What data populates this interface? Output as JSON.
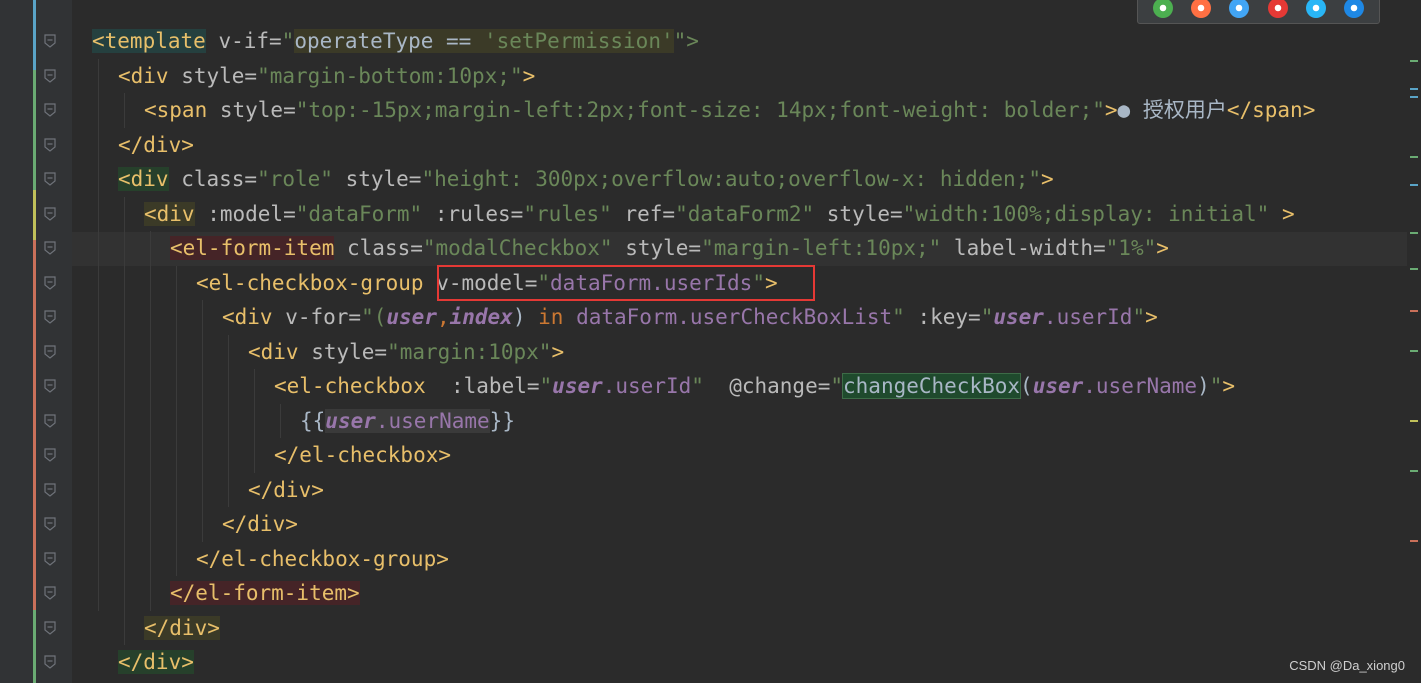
{
  "browser_icons": [
    {
      "name": "chrome-icon",
      "color": "#4caf50"
    },
    {
      "name": "firefox-icon",
      "color": "#ff7043"
    },
    {
      "name": "safari-icon",
      "color": "#42a5f5"
    },
    {
      "name": "opera-icon",
      "color": "#e53935"
    },
    {
      "name": "ie-icon",
      "color": "#29b6f6"
    },
    {
      "name": "edge-icon",
      "color": "#1e88e5"
    }
  ],
  "code": {
    "lines": [
      {
        "indent": 0,
        "tokens": [
          {
            "t": "<template",
            "c": "tag bg-teal"
          },
          {
            "t": " v-if=",
            "c": "attr"
          },
          {
            "t": "\"",
            "c": "str"
          },
          {
            "t": "operateType == ",
            "c": "vjs bg-olive"
          },
          {
            "t": "'setPermission'",
            "c": "str bg-olive"
          },
          {
            "t": "\">",
            "c": "str"
          }
        ]
      },
      {
        "indent": 1,
        "tokens": [
          {
            "t": "<div",
            "c": "tag"
          },
          {
            "t": " style=",
            "c": "attr"
          },
          {
            "t": "\"margin-bottom:10px;\"",
            "c": "str"
          },
          {
            "t": ">",
            "c": "tag"
          }
        ]
      },
      {
        "indent": 2,
        "tokens": [
          {
            "t": "<span",
            "c": "tag"
          },
          {
            "t": " style=",
            "c": "attr"
          },
          {
            "t": "\"top:-15px;margin-left:2px;font-size: 14px;font-weight: bolder;\"",
            "c": "str"
          },
          {
            "t": ">",
            "c": "tag"
          },
          {
            "t": "● 授权用户",
            "c": "vjs"
          },
          {
            "t": "</span>",
            "c": "tag"
          }
        ]
      },
      {
        "indent": 1,
        "tokens": [
          {
            "t": "</div>",
            "c": "tag"
          }
        ]
      },
      {
        "indent": 1,
        "tokens": [
          {
            "t": "<div",
            "c": "tag bg-green"
          },
          {
            "t": " class=",
            "c": "attr"
          },
          {
            "t": "\"role\"",
            "c": "str"
          },
          {
            "t": " style=",
            "c": "attr"
          },
          {
            "t": "\"height: 300px;overflow:auto;overflow-x: hidden;\"",
            "c": "str"
          },
          {
            "t": ">",
            "c": "tag"
          }
        ]
      },
      {
        "indent": 2,
        "tokens": [
          {
            "t": "<div",
            "c": "tag bg-olive"
          },
          {
            "t": " :model=",
            "c": "attr"
          },
          {
            "t": "\"dataForm\"",
            "c": "str"
          },
          {
            "t": " :rules=",
            "c": "attr"
          },
          {
            "t": "\"rules\"",
            "c": "str"
          },
          {
            "t": " ref=",
            "c": "attr"
          },
          {
            "t": "\"dataForm2\"",
            "c": "str"
          },
          {
            "t": " style=",
            "c": "attr"
          },
          {
            "t": "\"width:100%;display: initial\"",
            "c": "str"
          },
          {
            "t": " >",
            "c": "tag"
          }
        ]
      },
      {
        "indent": 3,
        "tokens": [
          {
            "t": "<el-form-item",
            "c": "tag bg-red"
          },
          {
            "t": " class=",
            "c": "attr"
          },
          {
            "t": "\"modalCheckbox\"",
            "c": "str"
          },
          {
            "t": " style=",
            "c": "attr"
          },
          {
            "t": "\"margin-left:10px;\"",
            "c": "str"
          },
          {
            "t": " label-width=",
            "c": "attr"
          },
          {
            "t": "\"1%\"",
            "c": "str"
          },
          {
            "t": ">",
            "c": "tag"
          }
        ]
      },
      {
        "indent": 4,
        "tokens": [
          {
            "t": "<el-checkbox-group",
            "c": "tag"
          },
          {
            "t": " v-model=",
            "c": "attr"
          },
          {
            "t": "\"",
            "c": "str"
          },
          {
            "t": "dataForm.userIds",
            "c": "prop"
          },
          {
            "t": "\"",
            "c": "str"
          },
          {
            "t": ">",
            "c": "tag"
          }
        ]
      },
      {
        "indent": 5,
        "tokens": [
          {
            "t": "<div",
            "c": "tag"
          },
          {
            "t": " v-for=",
            "c": "attr"
          },
          {
            "t": "\"(",
            "c": "str"
          },
          {
            "t": "user",
            "c": "var"
          },
          {
            "t": ",",
            "c": "kw"
          },
          {
            "t": "index",
            "c": "var"
          },
          {
            "t": ") ",
            "c": "vjs"
          },
          {
            "t": "in",
            "c": "kw"
          },
          {
            "t": " dataForm.userCheckBoxList",
            "c": "prop"
          },
          {
            "t": "\"",
            "c": "str"
          },
          {
            "t": " :key=",
            "c": "attr"
          },
          {
            "t": "\"",
            "c": "str"
          },
          {
            "t": "user",
            "c": "var"
          },
          {
            "t": ".userId",
            "c": "prop"
          },
          {
            "t": "\"",
            "c": "str"
          },
          {
            "t": ">",
            "c": "tag"
          }
        ]
      },
      {
        "indent": 6,
        "tokens": [
          {
            "t": "<div",
            "c": "tag"
          },
          {
            "t": " style=",
            "c": "attr"
          },
          {
            "t": "\"margin:10px\"",
            "c": "str"
          },
          {
            "t": ">",
            "c": "tag"
          }
        ]
      },
      {
        "indent": 7,
        "tokens": [
          {
            "t": "<el-checkbox",
            "c": "tag"
          },
          {
            "t": "  :label=",
            "c": "attr"
          },
          {
            "t": "\"",
            "c": "str"
          },
          {
            "t": "user",
            "c": "var"
          },
          {
            "t": ".userId",
            "c": "prop"
          },
          {
            "t": "\"",
            "c": "str"
          },
          {
            "t": "  @change=",
            "c": "attr"
          },
          {
            "t": "\"",
            "c": "str"
          },
          {
            "t": "changeCheckBox",
            "c": "vjs bg-fn"
          },
          {
            "t": "(",
            "c": "vjs"
          },
          {
            "t": "user",
            "c": "var"
          },
          {
            "t": ".userName",
            "c": "prop"
          },
          {
            "t": ")",
            "c": "vjs"
          },
          {
            "t": "\"",
            "c": "str"
          },
          {
            "t": ">",
            "c": "tag"
          }
        ]
      },
      {
        "indent": 8,
        "tokens": [
          {
            "t": "{{",
            "c": "vjs"
          },
          {
            "t": "user",
            "c": "var bg-gray"
          },
          {
            "t": ".userName",
            "c": "prop bg-gray"
          },
          {
            "t": "}}",
            "c": "vjs"
          }
        ]
      },
      {
        "indent": 7,
        "tokens": [
          {
            "t": "</el-checkbox>",
            "c": "tag"
          }
        ]
      },
      {
        "indent": 6,
        "tokens": [
          {
            "t": "</div>",
            "c": "tag"
          }
        ]
      },
      {
        "indent": 5,
        "tokens": [
          {
            "t": "</div>",
            "c": "tag"
          }
        ]
      },
      {
        "indent": 4,
        "tokens": [
          {
            "t": "</el-checkbox-group>",
            "c": "tag"
          }
        ]
      },
      {
        "indent": 3,
        "tokens": [
          {
            "t": "</el-form-item>",
            "c": "tag bg-red"
          }
        ]
      },
      {
        "indent": 2,
        "tokens": [
          {
            "t": "</div>",
            "c": "tag bg-olive"
          }
        ]
      },
      {
        "indent": 1,
        "tokens": [
          {
            "t": "</div>",
            "c": "tag bg-green"
          }
        ]
      }
    ]
  },
  "watermark": "CSDN @Da_xiong0"
}
